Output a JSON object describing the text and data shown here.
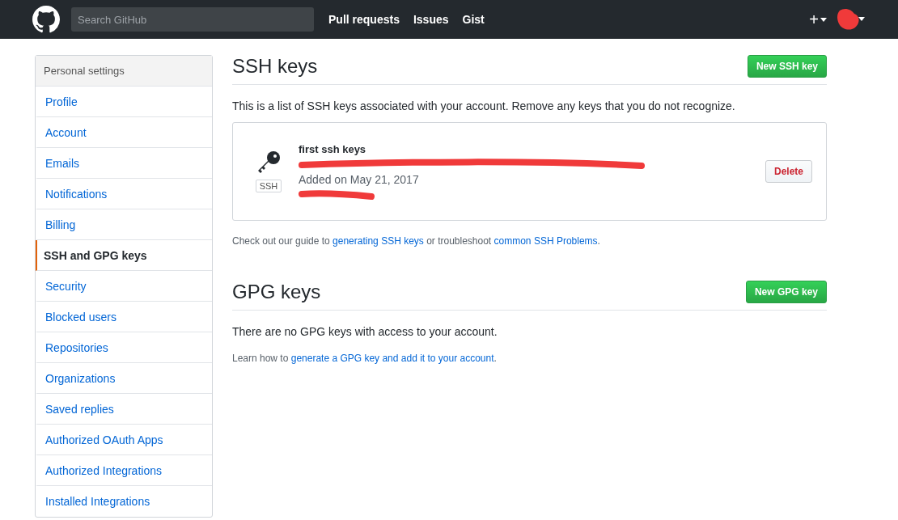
{
  "header": {
    "search": {
      "placeholder": "Search GitHub"
    },
    "nav": [
      "Pull requests",
      "Issues",
      "Gist"
    ],
    "plus": "+"
  },
  "sidebar": {
    "title": "Personal settings",
    "items": [
      {
        "label": "Profile",
        "selected": false
      },
      {
        "label": "Account",
        "selected": false
      },
      {
        "label": "Emails",
        "selected": false
      },
      {
        "label": "Notifications",
        "selected": false
      },
      {
        "label": "Billing",
        "selected": false
      },
      {
        "label": "SSH and GPG keys",
        "selected": true
      },
      {
        "label": "Security",
        "selected": false
      },
      {
        "label": "Blocked users",
        "selected": false
      },
      {
        "label": "Repositories",
        "selected": false
      },
      {
        "label": "Organizations",
        "selected": false
      },
      {
        "label": "Saved replies",
        "selected": false
      },
      {
        "label": "Authorized OAuth Apps",
        "selected": false
      },
      {
        "label": "Authorized Integrations",
        "selected": false
      },
      {
        "label": "Installed Integrations",
        "selected": false
      }
    ]
  },
  "ssh": {
    "title": "SSH keys",
    "button": "New SSH key",
    "intro": "This is a list of SSH keys associated with your account. Remove any keys that you do not recognize.",
    "keys": [
      {
        "title": "first ssh keys",
        "badge": "SSH",
        "added": "Added on May 21, 2017",
        "delete": "Delete"
      }
    ],
    "help": [
      {
        "kind": "text",
        "text": "Check out our guide to "
      },
      {
        "kind": "link",
        "text": "generating SSH keys"
      },
      {
        "kind": "text",
        "text": " or troubleshoot "
      },
      {
        "kind": "link",
        "text": "common SSH Problems"
      },
      {
        "kind": "text",
        "text": "."
      }
    ]
  },
  "gpg": {
    "title": "GPG keys",
    "button": "New GPG key",
    "empty": "There are no GPG keys with access to your account.",
    "help": [
      {
        "kind": "text",
        "text": "Learn how to "
      },
      {
        "kind": "link",
        "text": "generate a GPG key and add it to your account"
      },
      {
        "kind": "text",
        "text": "."
      }
    ]
  }
}
